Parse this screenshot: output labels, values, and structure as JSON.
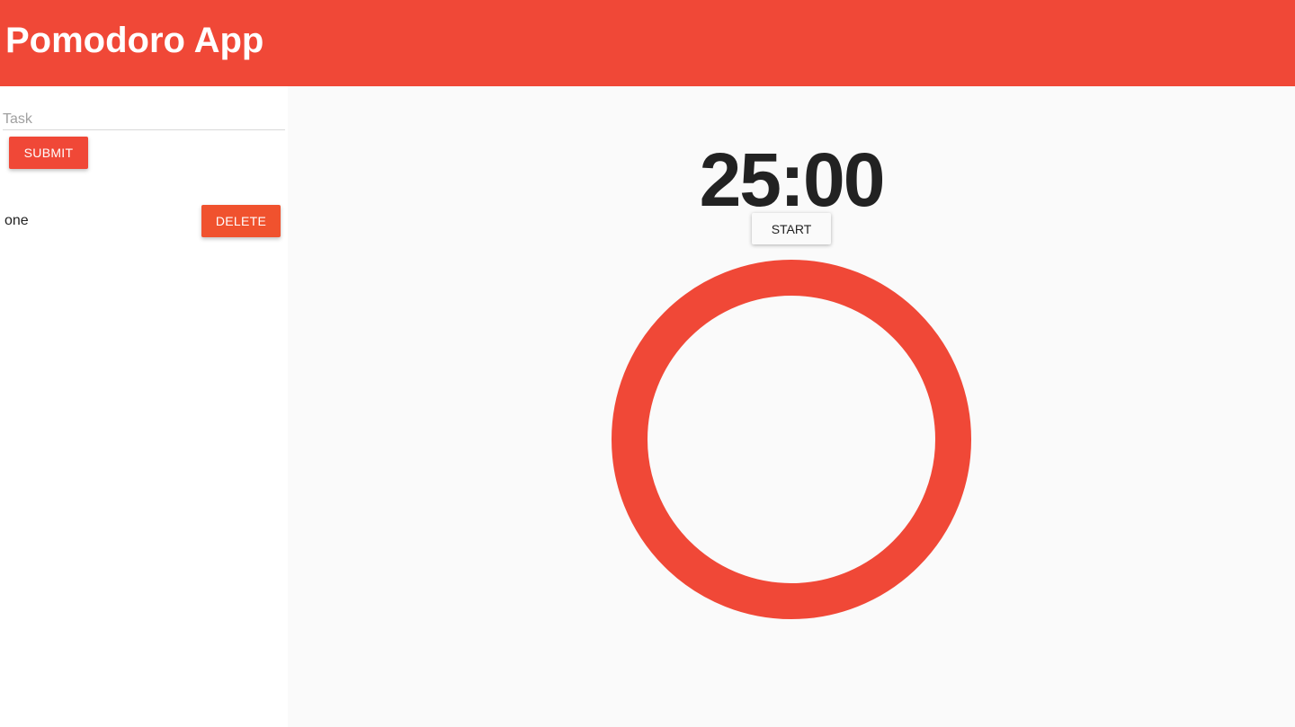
{
  "header": {
    "title": "Pomodoro App"
  },
  "sidebar": {
    "task_input": {
      "placeholder": "Task",
      "value": ""
    },
    "submit_label": "SUBMIT",
    "tasks": [
      {
        "label": "one",
        "delete_label": "DELETE"
      }
    ]
  },
  "timer": {
    "display": "25:00",
    "start_label": "START",
    "progress_ring": {
      "progress": 1.0,
      "color": "#f04837"
    }
  },
  "colors": {
    "accent": "#f04837",
    "delete": "#f0522e",
    "background": "#fafafa"
  }
}
